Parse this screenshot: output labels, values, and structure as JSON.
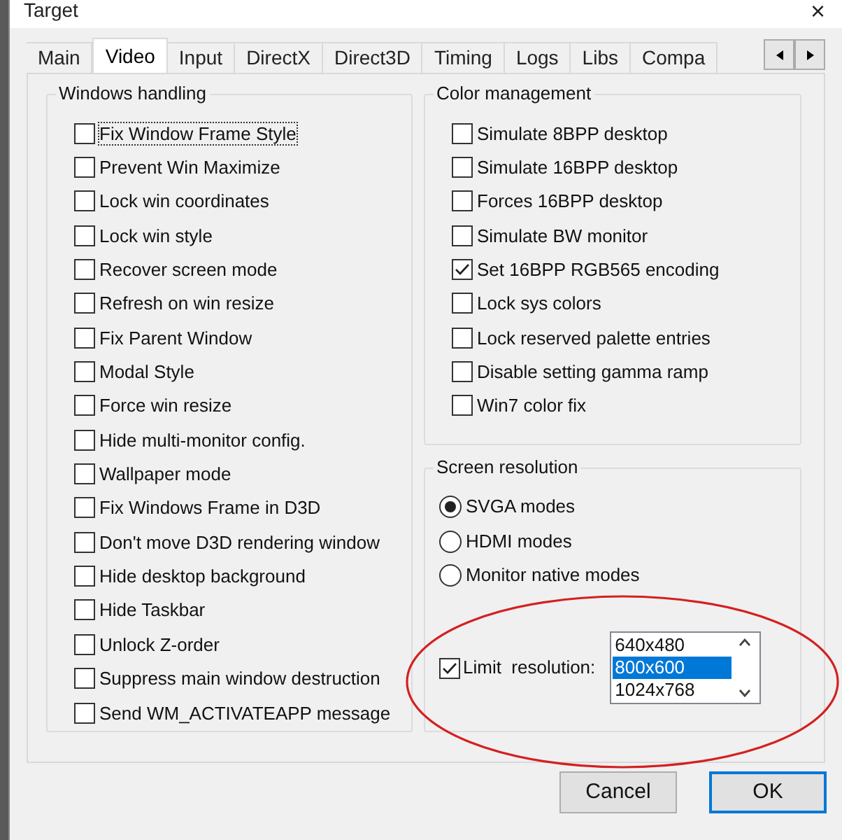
{
  "window": {
    "title": "Target",
    "close": "×"
  },
  "tabs": [
    {
      "label": "Main",
      "selected": false
    },
    {
      "label": "Video",
      "selected": true
    },
    {
      "label": "Input",
      "selected": false
    },
    {
      "label": "DirectX",
      "selected": false
    },
    {
      "label": "Direct3D",
      "selected": false
    },
    {
      "label": "Timing",
      "selected": false
    },
    {
      "label": "Logs",
      "selected": false
    },
    {
      "label": "Libs",
      "selected": false
    },
    {
      "label": "Compa",
      "selected": false
    }
  ],
  "windows_handling": {
    "title": "Windows handling",
    "options": [
      {
        "label": "Fix Window Frame Style",
        "checked": false,
        "focused": true
      },
      {
        "label": "Prevent Win Maximize",
        "checked": false
      },
      {
        "label": "Lock win coordinates",
        "checked": false
      },
      {
        "label": "Lock win style",
        "checked": false
      },
      {
        "label": "Recover screen mode",
        "checked": false
      },
      {
        "label": "Refresh on win resize",
        "checked": false
      },
      {
        "label": "Fix Parent Window",
        "checked": false
      },
      {
        "label": "Modal Style",
        "checked": false
      },
      {
        "label": "Force win resize",
        "checked": false
      },
      {
        "label": "Hide multi-monitor config.",
        "checked": false
      },
      {
        "label": "Wallpaper mode",
        "checked": false
      },
      {
        "label": "Fix Windows Frame in D3D",
        "checked": false
      },
      {
        "label": "Don't move D3D rendering window",
        "checked": false
      },
      {
        "label": "Hide desktop background",
        "checked": false
      },
      {
        "label": "Hide Taskbar",
        "checked": false
      },
      {
        "label": "Unlock Z-order",
        "checked": false
      },
      {
        "label": "Suppress main window destruction",
        "checked": false
      },
      {
        "label": "Send WM_ACTIVATEAPP message",
        "checked": false
      }
    ]
  },
  "color_management": {
    "title": "Color management",
    "options": [
      {
        "label": "Simulate 8BPP desktop",
        "checked": false
      },
      {
        "label": "Simulate 16BPP desktop",
        "checked": false
      },
      {
        "label": "Forces 16BPP desktop",
        "checked": false
      },
      {
        "label": "Simulate BW monitor",
        "checked": false
      },
      {
        "label": "Set 16BPP RGB565 encoding",
        "checked": true
      },
      {
        "label": "Lock sys colors",
        "checked": false
      },
      {
        "label": "Lock reserved palette entries",
        "checked": false
      },
      {
        "label": "Disable setting gamma ramp",
        "checked": false
      },
      {
        "label": "Win7 color fix",
        "checked": false
      }
    ]
  },
  "screen_resolution": {
    "title": "Screen resolution",
    "modes": [
      {
        "label": "SVGA modes",
        "selected": true
      },
      {
        "label": "HDMI modes",
        "selected": false
      },
      {
        "label": "Monitor native modes",
        "selected": false
      }
    ],
    "limit": {
      "label": "Limit  resolution:",
      "checked": true
    },
    "resolutions": [
      {
        "label": "640x480",
        "selected": false
      },
      {
        "label": "800x600",
        "selected": true
      },
      {
        "label": "1024x768",
        "selected": false
      }
    ]
  },
  "buttons": [
    {
      "label": "Cancel",
      "default": false
    },
    {
      "label": "OK",
      "default": true
    }
  ]
}
